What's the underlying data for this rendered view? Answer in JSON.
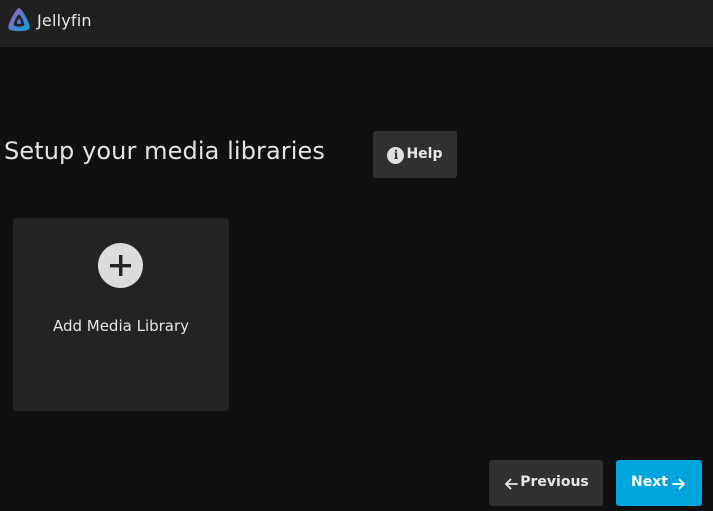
{
  "app": {
    "name": "Jellyfin",
    "logo_icon": "jellyfin-logo-icon"
  },
  "page": {
    "title": "Setup your media libraries"
  },
  "help": {
    "label": "Help",
    "icon": "info-icon",
    "icon_glyph": "i"
  },
  "library": {
    "add_label": "Add Media Library",
    "icon": "plus-icon"
  },
  "navigation": {
    "previous_label": "Previous",
    "previous_icon": "arrow-left-icon",
    "next_label": "Next",
    "next_icon": "arrow-right-icon"
  },
  "colors": {
    "background": "#101010",
    "header": "#202020",
    "card": "#232323",
    "button": "#303030",
    "accent": "#00a4dc"
  }
}
